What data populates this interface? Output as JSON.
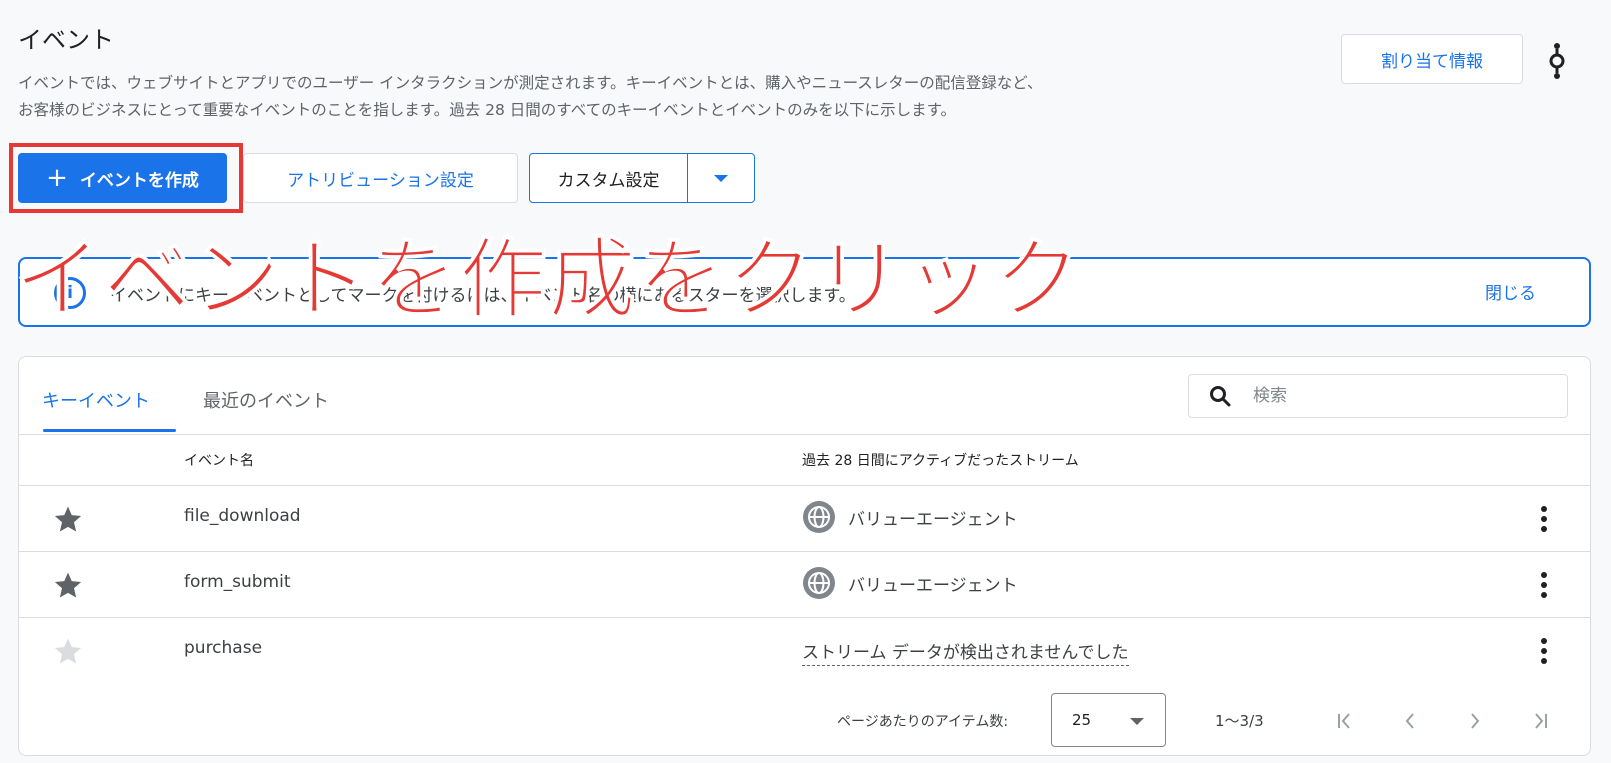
{
  "page": {
    "title": "イベント",
    "description_lines": [
      "イベントでは、ウェブサイトとアプリでのユーザー インタラクションが測定されます。キーイベントとは、購入やニュースレターの配信登録など、",
      "お客様のビジネスにとって重要なイベントのことを指します。過去 28 日間のすべてのキーイベントとイベントのみを以下に示します。"
    ]
  },
  "header_actions": {
    "attribution_info_label": "割り当て情報",
    "help_icon": "help-connection-icon"
  },
  "toolbar": {
    "create_label": "イベントを作成",
    "attribution_settings_label": "アトリビューション設定",
    "custom_settings_label": "カスタム設定"
  },
  "banner": {
    "text": "イベントにキーイベントとしてマークを付けるには、イベント名の横にあるスターを選択します。",
    "close_label": "閉じる"
  },
  "overlay": {
    "text": "イベントを作成をクリック",
    "color": "#e53935"
  },
  "tabs": [
    {
      "label": "キーイベント",
      "active": true
    },
    {
      "label": "最近のイベント",
      "active": false
    }
  ],
  "search": {
    "placeholder": "検索"
  },
  "table": {
    "columns": [
      "イベント名",
      "過去 28 日間にアクティブだったストリーム"
    ],
    "rows": [
      {
        "starred": true,
        "name": "file_download",
        "stream": "バリューエージェント",
        "has_stream": true
      },
      {
        "starred": true,
        "name": "form_submit",
        "stream": "バリューエージェント",
        "has_stream": true
      },
      {
        "starred": false,
        "name": "purchase",
        "stream": "ストリーム データが検出されませんでした",
        "has_stream": false
      }
    ]
  },
  "pagination": {
    "per_page_label": "ページあたりのアイテム数:",
    "per_page_value": "25",
    "range": "1～3/3"
  },
  "colors": {
    "accent": "#1a73e8",
    "highlight": "#e53935",
    "star_active": "#5f6368",
    "star_inactive": "#dadce0"
  }
}
